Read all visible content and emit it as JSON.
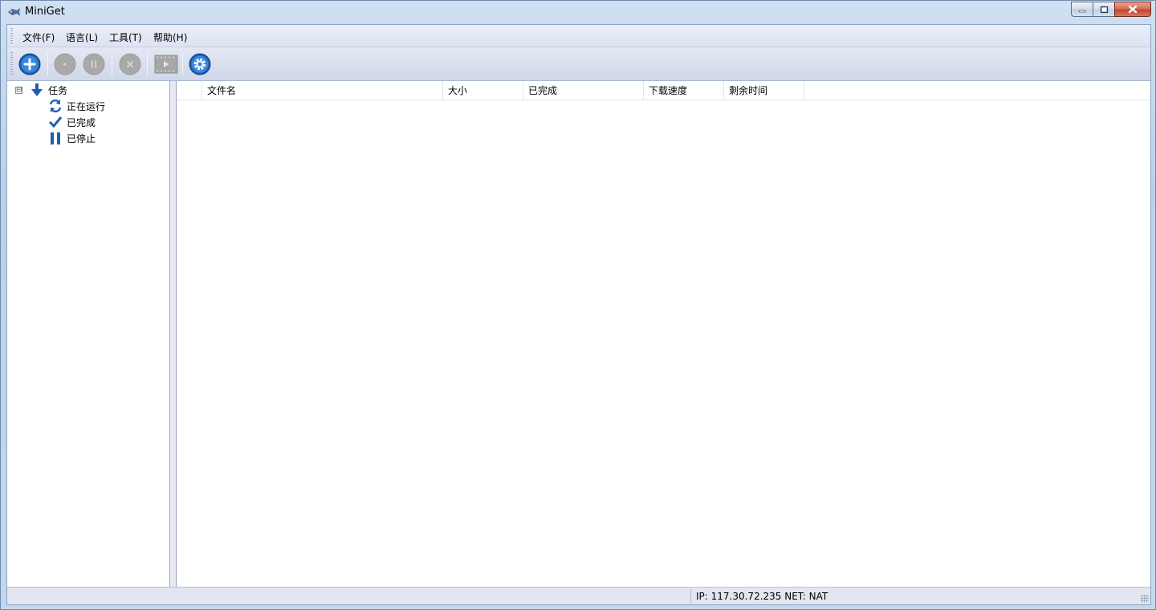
{
  "window": {
    "title": "MiniGet",
    "controls": {
      "minimize": "minimize",
      "maximize": "maximize",
      "close": "close"
    }
  },
  "menu": [
    {
      "label": "文件(F)"
    },
    {
      "label": "语言(L)"
    },
    {
      "label": "工具(T)"
    },
    {
      "label": "帮助(H)"
    }
  ],
  "toolbar": {
    "buttons": [
      {
        "name": "add-task",
        "icon": "plus-circle-icon",
        "enabled": true
      },
      {
        "name": "start",
        "icon": "play-icon",
        "enabled": false
      },
      {
        "name": "pause",
        "icon": "pause-icon",
        "enabled": false
      },
      {
        "name": "delete",
        "icon": "x-icon",
        "enabled": false
      },
      {
        "name": "preview",
        "icon": "film-play-icon",
        "enabled": false
      },
      {
        "name": "settings",
        "icon": "gear-icon",
        "enabled": true
      }
    ]
  },
  "tree": {
    "root": {
      "label": "任务",
      "icon": "down-arrow-icon",
      "expander": "⊟"
    },
    "children": [
      {
        "label": "正在运行",
        "icon": "refresh-icon"
      },
      {
        "label": "已完成",
        "icon": "check-icon"
      },
      {
        "label": "已停止",
        "icon": "pause-bars-icon"
      }
    ]
  },
  "list": {
    "columns": [
      {
        "label": ""
      },
      {
        "label": "文件名"
      },
      {
        "label": "大小"
      },
      {
        "label": "已完成"
      },
      {
        "label": "下载速度"
      },
      {
        "label": "剩余时间"
      }
    ],
    "rows": []
  },
  "status": {
    "text": "IP: 117.30.72.235 NET: NAT"
  },
  "colors": {
    "accent": "#1e5fb4",
    "disabled": "#a9a9a9",
    "close": "#c3452b"
  }
}
